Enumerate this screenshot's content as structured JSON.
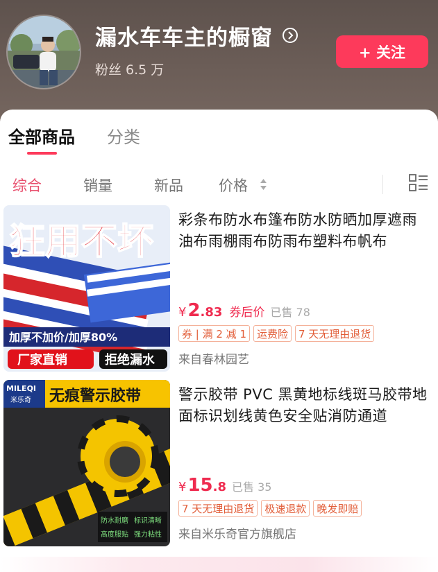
{
  "header": {
    "shop_name": "漏水车车主的橱窗",
    "fans": "粉丝 6.5 万",
    "follow_label": "+ 关注",
    "colors": {
      "accent": "#fd3a5b",
      "header_bg": "#65584f"
    }
  },
  "tabs": [
    {
      "label": "全部商品",
      "active": true
    },
    {
      "label": "分类",
      "active": false
    }
  ],
  "sort": {
    "items": [
      {
        "label": "综合",
        "active": true
      },
      {
        "label": "销量",
        "active": false
      },
      {
        "label": "新品",
        "active": false
      },
      {
        "label": "价格",
        "active": false
      }
    ],
    "price_icon": "sort-updown-icon",
    "layout_icon": "list-layout-icon"
  },
  "products": [
    {
      "title": "彩条布防水布篷布防水防晒加厚遮雨油布雨棚雨布防雨布塑料布帆布",
      "price_symbol": "¥",
      "price_int": "2",
      "price_dec": ".83",
      "price_label": "券后价",
      "sold": "已售 78",
      "tags": [
        "券 | 满 2 减 1",
        "运费险",
        "7 天无理由退货"
      ],
      "shop": "来自春林园艺",
      "image": {
        "headline": "狂用不坏",
        "sub": "加厚不加价/加厚80%",
        "badge1": "厂家直销",
        "badge2": "拒绝漏水"
      }
    },
    {
      "title": "警示胶带 PVC 黑黄地标线斑马胶带地面标识划线黄色安全贴消防通道",
      "price_symbol": "¥",
      "price_int": "15",
      "price_dec": ".8",
      "price_label": "",
      "sold": "已售 35",
      "tags": [
        "7 天无理由退货",
        "极速退款",
        "晚发即赔"
      ],
      "shop": "来自米乐奇官方旗舰店",
      "image": {
        "brand": "MILEQI",
        "brand_cn": "米乐奇",
        "headline": "无痕警示胶带",
        "features": [
          "防水耐磨",
          "标识清晰",
          "高度服贴",
          "强力粘性"
        ]
      }
    }
  ]
}
